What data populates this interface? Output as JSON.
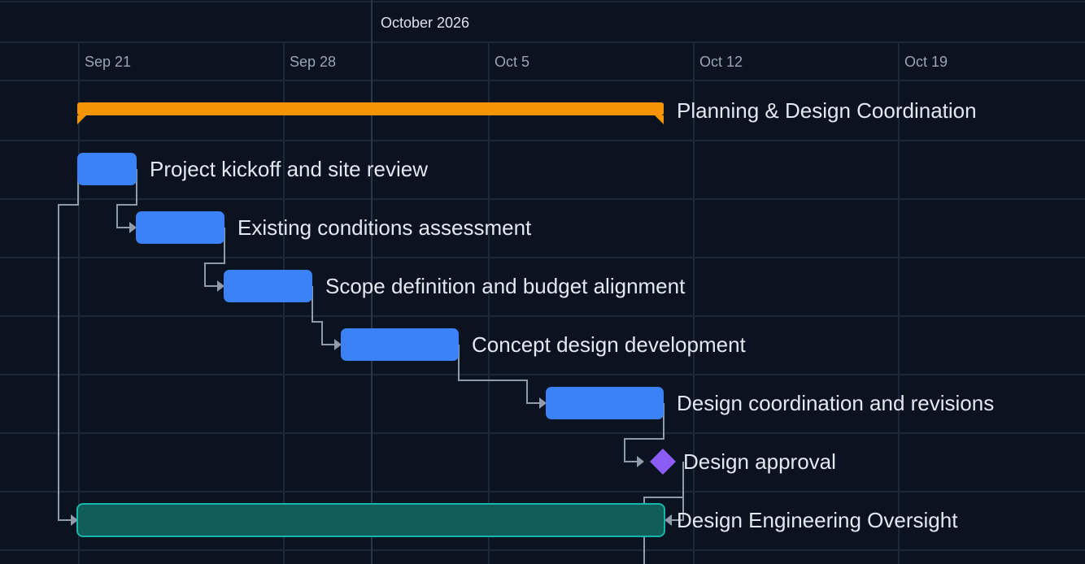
{
  "timeline": {
    "month": "October 2026",
    "days": [
      "Sep 21",
      "Sep 28",
      "Oct 5",
      "Oct 12",
      "Oct 19"
    ]
  },
  "tasks": [
    {
      "name": "Planning & Design Coordination",
      "type": "summary"
    },
    {
      "name": "Project kickoff and site review",
      "type": "task"
    },
    {
      "name": "Existing conditions assessment",
      "type": "task"
    },
    {
      "name": "Scope definition and budget alignment",
      "type": "task"
    },
    {
      "name": "Concept design development",
      "type": "task"
    },
    {
      "name": "Design coordination and revisions",
      "type": "task"
    },
    {
      "name": "Design approval",
      "type": "milestone"
    },
    {
      "name": "Design Engineering Oversight",
      "type": "hammock"
    }
  ],
  "colors": {
    "background": "#0b1220",
    "grid": "#1c2737",
    "summary": "#f59505",
    "task": "#3b82f6",
    "milestone": "#8b5cf6",
    "hammock_fill": "#115e59",
    "hammock_border": "#14b8a6",
    "connector": "#8f9aab"
  }
}
